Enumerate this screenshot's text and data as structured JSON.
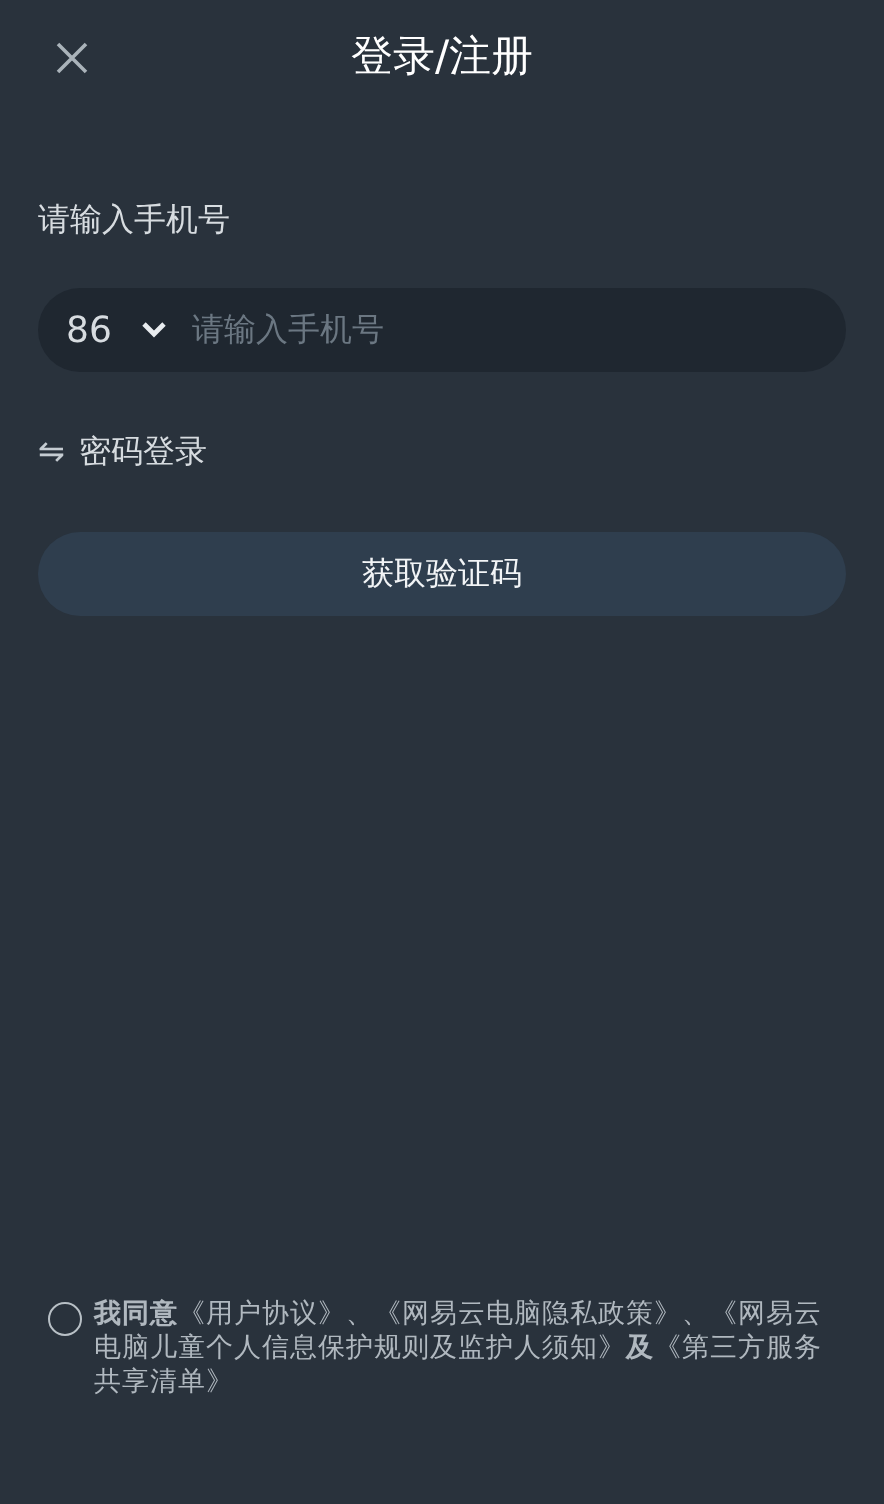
{
  "header": {
    "title": "登录/注册"
  },
  "phone_label": "请输入手机号",
  "phone_field": {
    "country_code": "86",
    "placeholder": "请输入手机号"
  },
  "switch_login": {
    "icon": "⇋",
    "label": "密码登录"
  },
  "submit_button": "获取验证码",
  "agreement": {
    "checked": false,
    "text": "**我同意**《用户协议》、《网易云电脑隐私政策》、《网易云电脑儿童个人信息保护规则及监护人须知》**及**《第三方服务共享清单》"
  }
}
